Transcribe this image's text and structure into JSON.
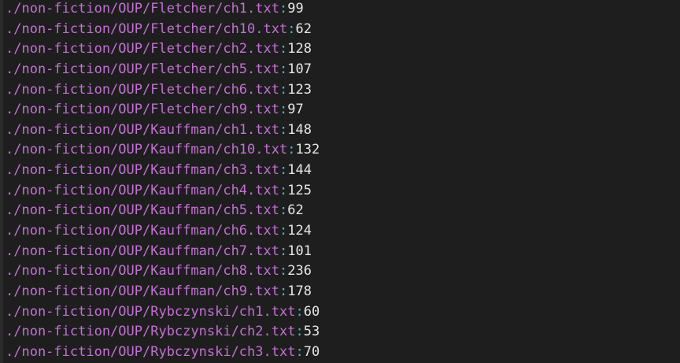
{
  "colors": {
    "background": "#1e1e1e",
    "path": "#c470d4",
    "separator": "#4fb8c9",
    "count": "#e6e6e6"
  },
  "output": {
    "separator": ":",
    "lines": [
      {
        "path": "./non-fiction/OUP/Fletcher/ch1.txt",
        "count": "99"
      },
      {
        "path": "./non-fiction/OUP/Fletcher/ch10.txt",
        "count": "62"
      },
      {
        "path": "./non-fiction/OUP/Fletcher/ch2.txt",
        "count": "128"
      },
      {
        "path": "./non-fiction/OUP/Fletcher/ch5.txt",
        "count": "107"
      },
      {
        "path": "./non-fiction/OUP/Fletcher/ch6.txt",
        "count": "123"
      },
      {
        "path": "./non-fiction/OUP/Fletcher/ch9.txt",
        "count": "97"
      },
      {
        "path": "./non-fiction/OUP/Kauffman/ch1.txt",
        "count": "148"
      },
      {
        "path": "./non-fiction/OUP/Kauffman/ch10.txt",
        "count": "132"
      },
      {
        "path": "./non-fiction/OUP/Kauffman/ch3.txt",
        "count": "144"
      },
      {
        "path": "./non-fiction/OUP/Kauffman/ch4.txt",
        "count": "125"
      },
      {
        "path": "./non-fiction/OUP/Kauffman/ch5.txt",
        "count": "62"
      },
      {
        "path": "./non-fiction/OUP/Kauffman/ch6.txt",
        "count": "124"
      },
      {
        "path": "./non-fiction/OUP/Kauffman/ch7.txt",
        "count": "101"
      },
      {
        "path": "./non-fiction/OUP/Kauffman/ch8.txt",
        "count": "236"
      },
      {
        "path": "./non-fiction/OUP/Kauffman/ch9.txt",
        "count": "178"
      },
      {
        "path": "./non-fiction/OUP/Rybczynski/ch1.txt",
        "count": "60"
      },
      {
        "path": "./non-fiction/OUP/Rybczynski/ch2.txt",
        "count": "53"
      },
      {
        "path": "./non-fiction/OUP/Rybczynski/ch3.txt",
        "count": "70"
      }
    ]
  }
}
